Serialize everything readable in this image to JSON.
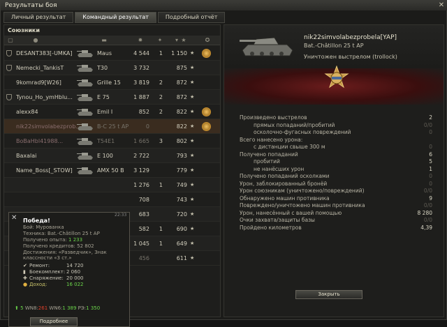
{
  "window": {
    "title": "Результаты боя"
  },
  "tabs": [
    {
      "label": "Личный результат",
      "active": false
    },
    {
      "label": "Командный результат",
      "active": true
    },
    {
      "label": "Подробный отчёт",
      "active": false
    }
  ],
  "team": {
    "section_title": "Союзники",
    "players": [
      {
        "name": "DESANT383[-UMKA]",
        "tank": "Maus",
        "damage": "4 544",
        "kills": "1",
        "xp": "1 150",
        "medal": true,
        "badge": true,
        "dead": false,
        "self": false,
        "dim": false
      },
      {
        "name": "Nemecki_TankisT",
        "tank": "T30",
        "damage": "3 732",
        "kills": "",
        "xp": "875",
        "medal": false,
        "badge": true,
        "dead": false,
        "self": false,
        "dim": false
      },
      {
        "name": "9komrad9[W26]",
        "tank": "Grille 15",
        "damage": "3 819",
        "kills": "2",
        "xp": "872",
        "medal": false,
        "badge": false,
        "dead": false,
        "self": false,
        "dim": false
      },
      {
        "name": "Tynou_Ho_ymHblu...",
        "tank": "E 75",
        "damage": "1 887",
        "kills": "2",
        "xp": "872",
        "medal": false,
        "badge": true,
        "dead": false,
        "self": false,
        "dim": false
      },
      {
        "name": "alexx84",
        "tank": "Emil I",
        "damage": "852",
        "kills": "2",
        "xp": "822",
        "medal": true,
        "badge": false,
        "dead": false,
        "self": false,
        "dim": false
      },
      {
        "name": "nik22simvolabezprob...",
        "tank": "B-C 25 t AP",
        "damage": "0",
        "kills": "",
        "xp": "822",
        "medal": true,
        "badge": false,
        "dead": true,
        "self": true,
        "dim": true
      },
      {
        "name": "BoBaHbl41988...",
        "tank": "T54E1",
        "damage": "1 665",
        "kills": "3",
        "xp": "802",
        "medal": false,
        "badge": false,
        "dead": true,
        "self": false,
        "dim": true
      },
      {
        "name": "Baxalai",
        "tank": "E 100",
        "damage": "2 722",
        "kills": "",
        "xp": "793",
        "medal": false,
        "badge": false,
        "dead": false,
        "self": false,
        "dim": false
      },
      {
        "name": "Name_Boss[_STOW]",
        "tank": "AMX 50 B",
        "damage": "3 129",
        "kills": "",
        "xp": "779",
        "medal": false,
        "badge": false,
        "dead": false,
        "self": false,
        "dim": false
      },
      {
        "name": "",
        "tank": "",
        "damage": "1 276",
        "kills": "1",
        "xp": "749",
        "medal": false,
        "badge": false,
        "dead": false,
        "self": false,
        "dim": false
      },
      {
        "name": "",
        "tank": "",
        "damage": "708",
        "kills": "",
        "xp": "743",
        "medal": false,
        "badge": false,
        "dead": false,
        "self": false,
        "dim": false
      },
      {
        "name": "",
        "tank": "",
        "damage": "683",
        "kills": "",
        "xp": "720",
        "medal": false,
        "badge": false,
        "dead": false,
        "self": false,
        "dim": false
      },
      {
        "name": "",
        "tank": "",
        "damage": "582",
        "kills": "1",
        "xp": "690",
        "medal": false,
        "badge": false,
        "dead": false,
        "self": false,
        "dim": false
      },
      {
        "name": "",
        "tank": "",
        "damage": "1 045",
        "kills": "1",
        "xp": "649",
        "medal": false,
        "badge": false,
        "dead": false,
        "self": false,
        "dim": false
      },
      {
        "name": "",
        "tank": "",
        "damage": "456",
        "kills": "",
        "xp": "611",
        "medal": false,
        "badge": false,
        "dead": true,
        "self": false,
        "dim": true
      }
    ]
  },
  "popup": {
    "title": "Победа!",
    "time": "22:33",
    "battle": "Бой: Мурованка",
    "vehicle": "Техника: Bat.-Châtillon 25 t AP",
    "xp_label": "Получено опыта:",
    "xp_value": "1 233",
    "credits_label": "Получено кредитов:",
    "credits_value": "52 802",
    "achievements_1": "Достижения: «Разведчик», Знак",
    "achievements_2": "классности «3 ст.»",
    "repair_label": "Ремонт:",
    "repair_value": "14 720",
    "ammo_label": "Боекомплект:",
    "ammo_value": "2 060",
    "equipment_label": "Снаряжение:",
    "equipment_value": "20 000",
    "income_label": "Доход:",
    "income_value": "16 022",
    "footer_count": "5",
    "wn8_label": "WN8:",
    "wn8_value": "261",
    "wn6_label": "WN6:",
    "wn6_value": "1 389",
    "rating_label": "РЭ:",
    "rating_value": "1 350",
    "more_button": "Подробнее"
  },
  "detail": {
    "player_name": "nik22simvolabezprobela[YAP]",
    "vehicle": "Bat.-Châtillon 25 t AP",
    "killed_by": "Уничтожен выстрелом (trollock)",
    "stats": [
      {
        "label": "Произведено выстрелов",
        "value": "2",
        "sub": false,
        "zero": false
      },
      {
        "label": "прямых попаданий/пробитий",
        "value": "0/0",
        "sub": true,
        "zero": true
      },
      {
        "label": "осколочно-фугасных повреждений",
        "value": "0",
        "sub": true,
        "zero": true
      },
      {
        "label": "Всего нанесено урона:",
        "value": "",
        "sub": false,
        "zero": false
      },
      {
        "label": "с дистанции свыше 300 м",
        "value": "0",
        "sub": true,
        "zero": true
      },
      {
        "label": "Получено попаданий",
        "value": "6",
        "sub": false,
        "zero": false
      },
      {
        "label": "пробитий",
        "value": "5",
        "sub": true,
        "zero": false
      },
      {
        "label": "не нанёсших урон",
        "value": "1",
        "sub": true,
        "zero": false
      },
      {
        "label": "Получено попаданий осколками",
        "value": "0",
        "sub": false,
        "zero": true
      },
      {
        "label": "Урон, заблокированный бронёй",
        "value": "0",
        "sub": false,
        "zero": true
      },
      {
        "label": "Урон союзникам (уничтожено/повреждений)",
        "value": "0/0",
        "sub": false,
        "zero": true
      },
      {
        "label": "Обнаружено машин противника",
        "value": "9",
        "sub": false,
        "zero": false
      },
      {
        "label": "Повреждено/уничтожено машин противника",
        "value": "0/0",
        "sub": false,
        "zero": true
      },
      {
        "label": "Урон, нанесённый с вашей помощью",
        "value": "8 280",
        "sub": false,
        "zero": false
      },
      {
        "label": "Очки захвата/защиты базы",
        "value": "0/0",
        "sub": false,
        "zero": true
      },
      {
        "label": "Пройдено километров",
        "value": "4,39",
        "sub": false,
        "zero": false
      }
    ],
    "close_button": "Закрыть"
  },
  "colors": {
    "accent_green": "#6bd64a",
    "accent_red": "#e0402a",
    "self_row": "#3a2c1f"
  }
}
